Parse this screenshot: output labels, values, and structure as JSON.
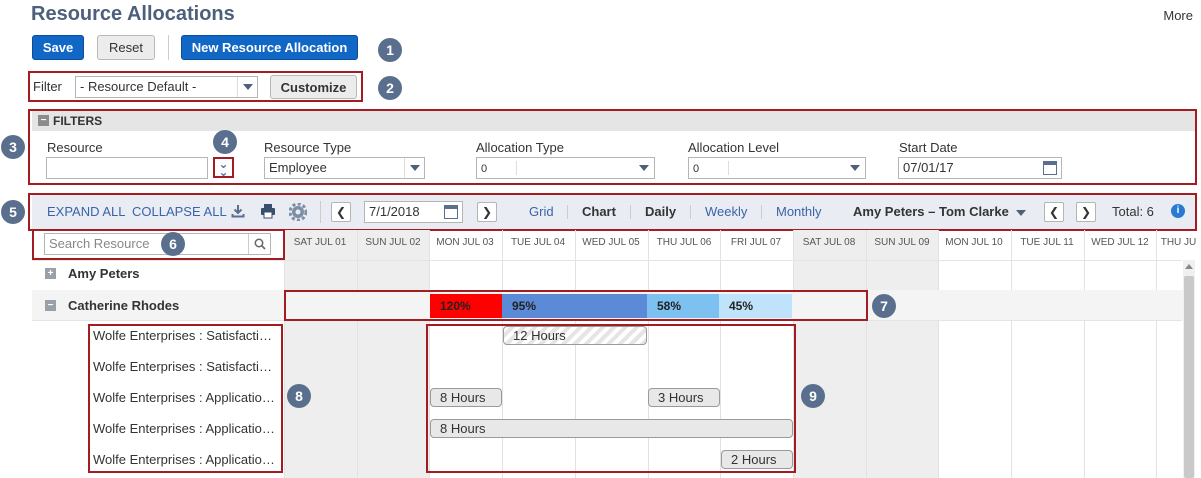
{
  "page": {
    "title": "Resource Allocations",
    "more_label": "More"
  },
  "actions": {
    "save_label": "Save",
    "reset_label": "Reset",
    "new_label": "New Resource Allocation"
  },
  "filter_bar": {
    "label": "Filter",
    "selected": "- Resource Default -",
    "customize_label": "Customize"
  },
  "filters": {
    "header": "FILTERS",
    "resource_label": "Resource",
    "resource_value": "",
    "resource_type_label": "Resource Type",
    "resource_type_value": "Employee",
    "allocation_type_label": "Allocation Type",
    "allocation_type_value": "0",
    "allocation_level_label": "Allocation Level",
    "allocation_level_value": "0",
    "start_date_label": "Start Date",
    "start_date_value": "07/01/17"
  },
  "toolbar": {
    "expand_all": "EXPAND ALL",
    "collapse_all": "COLLAPSE ALL",
    "date_value": "7/1/2018",
    "grid_label": "Grid",
    "chart_label": "Chart",
    "daily_label": "Daily",
    "weekly_label": "Weekly",
    "monthly_label": "Monthly",
    "range_label": "Amy Peters – Tom Clarke",
    "total_label": "Total: 6"
  },
  "search": {
    "placeholder": "Search Resource"
  },
  "days": [
    "SAT JUL 01",
    "SUN JUL 02",
    "MON JUL 03",
    "TUE JUL 04",
    "WED JUL 05",
    "THU JUL 06",
    "FRI JUL 07",
    "SAT JUL 08",
    "SUN JUL 09",
    "MON JUL 10",
    "TUE JUL 11",
    "WED JUL 12",
    "THU JU"
  ],
  "resources": [
    {
      "name": "Amy Peters",
      "toggle": "+"
    },
    {
      "name": "Catherine Rhodes",
      "toggle": "−"
    }
  ],
  "utilization": [
    {
      "label": "120%",
      "color": "#ff0000"
    },
    {
      "label": "95%",
      "color": "#5b8bd6"
    },
    {
      "label": "58%",
      "color": "#7cc1f0"
    },
    {
      "label": "45%",
      "color": "#bfe3fb"
    }
  ],
  "projects": [
    "Wolfe Enterprises : Satisfaction Survey",
    "Wolfe Enterprises : Satisfaction Survey",
    "Wolfe Enterprises : Application Upgrade",
    "Wolfe Enterprises : Application Upgrade",
    "Wolfe Enterprises : Application Upgrade"
  ],
  "allocations": [
    {
      "label": "12 Hours",
      "tentative": true
    },
    {
      "label": "8 Hours",
      "tentative": false
    },
    {
      "label": "3 Hours",
      "tentative": false
    },
    {
      "label": "8 Hours",
      "tentative": false
    },
    {
      "label": "2 Hours",
      "tentative": false
    }
  ],
  "callouts": [
    "1",
    "2",
    "3",
    "4",
    "5",
    "6",
    "7",
    "8",
    "9"
  ],
  "colors": {
    "primary": "#1167c5",
    "highlight_box": "#a31c22",
    "badge": "#5a6f8e"
  }
}
